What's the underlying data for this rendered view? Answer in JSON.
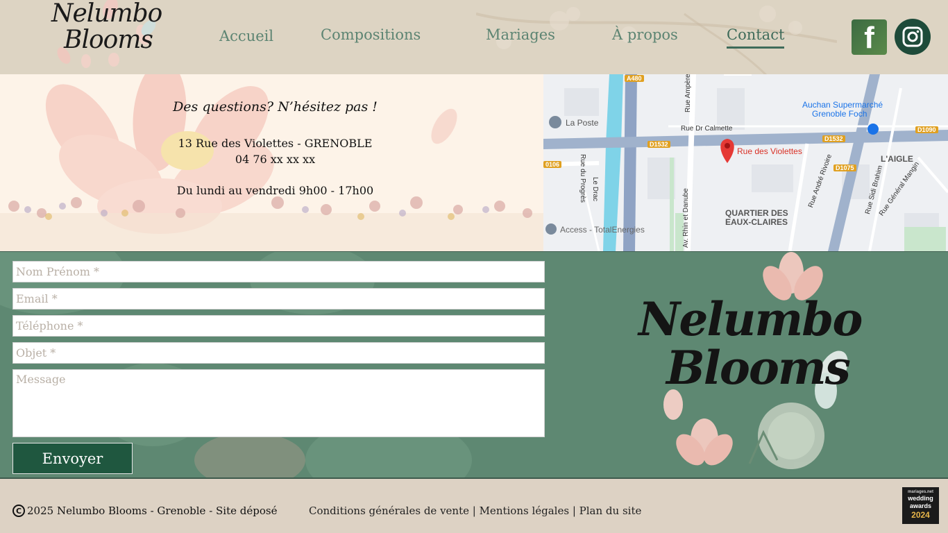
{
  "brand": {
    "logo_line1": "Nelumbo",
    "logo_line2": "Blooms"
  },
  "nav": {
    "items": [
      {
        "label": "Accueil"
      },
      {
        "label": "Compositions"
      },
      {
        "label": "Mariages"
      },
      {
        "label": "À propos"
      },
      {
        "label": "Contact",
        "active": true
      }
    ]
  },
  "social": {
    "facebook_label": "f"
  },
  "contact_info": {
    "title": "Des questions? N’hésitez pas !",
    "address": "13 Rue des Violettes - GRENOBLE",
    "phone": "04 76 xx xx xx",
    "hours": "Du lundi au vendredi 9h00 - 17h00"
  },
  "map": {
    "pin_label": "Rue des Violettes",
    "places": {
      "la_poste": "La Poste",
      "auchan_line1": "Auchan Supermarché",
      "auchan_line2": "Grenoble Foch",
      "quartier_line1": "QUARTIER DES",
      "quartier_line2": "EAUX-CLAIRES",
      "l_aigle": "L'AIGLE",
      "access": "Access - TotalEnergies"
    },
    "roads": {
      "dr_calmette": "Rue Dr Calmette",
      "le_drac": "Le Drac",
      "progres": "Rue du Progrès",
      "ampere": "Rue Ampère",
      "rhin_danube": "Av. Rhin et Danube",
      "andre_rivoire": "Rue André Rivoire",
      "sidi_brahim": "Rue Sidi Brahim",
      "general_mangin": "Rue Général Mangin"
    },
    "shields": {
      "a480": "A480",
      "d1532a": "D1532",
      "d1532b": "D1532",
      "d1090": "D1090",
      "d1075": "D1075",
      "d106": "0106"
    }
  },
  "form": {
    "name_placeholder": "Nom Prénom *",
    "email_placeholder": "Email *",
    "phone_placeholder": "Téléphone *",
    "subject_placeholder": "Objet *",
    "message_placeholder": "Message",
    "submit_label": "Envoyer"
  },
  "footer": {
    "copyright": "2025 Nelumbo Blooms - Grenoble - Site déposé",
    "copyright_symbol": "C",
    "links": {
      "cgv": "Conditions générales de vente",
      "sep1": " | ",
      "legal": "Mentions légales",
      "sep2": " | ",
      "sitemap": "Plan du site"
    },
    "award": {
      "line1": "mariages.net",
      "line2a": "wedding",
      "line2b": "awards",
      "year": "2024"
    }
  },
  "colors": {
    "accent_green": "#1f573f",
    "nav_green": "#5c8472",
    "form_bg": "#5e8872"
  }
}
